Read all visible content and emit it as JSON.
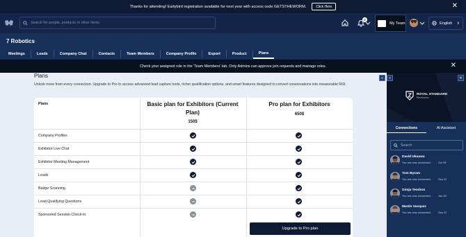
{
  "announcement": {
    "text": "Thanks for attending! Earlybird registration available for next year with access code GETSTHEWORM.",
    "button_label": "Click Here",
    "close_icon": "close-icon"
  },
  "topnav": {
    "search_placeholder": "Search for people, products or other items",
    "notification_count": "2",
    "team_label": "My Team",
    "language": "English"
  },
  "company": {
    "name": "7 Robotics",
    "tabs": [
      {
        "label": "Meetings",
        "active": false
      },
      {
        "label": "Leads",
        "active": false
      },
      {
        "label": "Company Chat",
        "active": false
      },
      {
        "label": "Contacts",
        "active": false
      },
      {
        "label": "Team Members",
        "active": false
      },
      {
        "label": "Company Profile",
        "active": false
      },
      {
        "label": "Export",
        "active": false
      },
      {
        "label": "Product",
        "active": false
      },
      {
        "label": "Plans",
        "active": true
      }
    ]
  },
  "info_bar": {
    "text": "Check your assigned role in the 'Team Members' tab. Only Admins can approve join requests and manage roles."
  },
  "plans": {
    "title": "Plans",
    "description": "Unlock more from every connection. Upgrade to Pro to access advanced lead capture tools, richer qualification options, and smart features designed to convert conversations into measurable ROI.",
    "header_label": "Plans",
    "basic": {
      "name": "Basic plan for Exhibitors (Current Plan)",
      "price": "150$"
    },
    "pro": {
      "name": "Pro plan for Exhibitors",
      "price": "650$"
    },
    "features": [
      {
        "label": "Company Profiles",
        "basic": true,
        "pro": true
      },
      {
        "label": "Exhibitor Live Chat",
        "basic": true,
        "pro": true
      },
      {
        "label": "Exhibitor Meeting Management",
        "basic": true,
        "pro": true
      },
      {
        "label": "Leads",
        "basic": true,
        "pro": true
      },
      {
        "label": "Badge Scanning",
        "basic": false,
        "pro": true
      },
      {
        "label": "Lead Qualifying Questions",
        "basic": false,
        "pro": true
      },
      {
        "label": "Sponsored Session Check-in",
        "basic": false,
        "pro": true
      }
    ],
    "upgrade_label": "Upgrade to Pro plan"
  },
  "sidebar": {
    "sponsor": {
      "name": "ROYAL STANDARD",
      "sub": "Electronics"
    },
    "tabs": [
      {
        "label": "Connections",
        "active": true
      },
      {
        "label": "AI Assistant",
        "active": false
      }
    ],
    "search_placeholder": "Search",
    "contacts": [
      {
        "name": "David Ukauwa",
        "message": "You are now connected...",
        "date": "Oct 08"
      },
      {
        "name": "Tom Byram",
        "message": "You are now connected...",
        "date": "Sep 22"
      },
      {
        "name": "Gimja Teodros",
        "message": "You are now connected...",
        "date": "Jan 28"
      },
      {
        "name": "Martin Vasquez",
        "message": "You are now connected...",
        "date": "Sep 22"
      }
    ]
  },
  "colors": {
    "navy_dark": "#0c1a33",
    "navy": "#13264a",
    "company_bar": "#17305a",
    "page_bg": "#e8edf6"
  }
}
